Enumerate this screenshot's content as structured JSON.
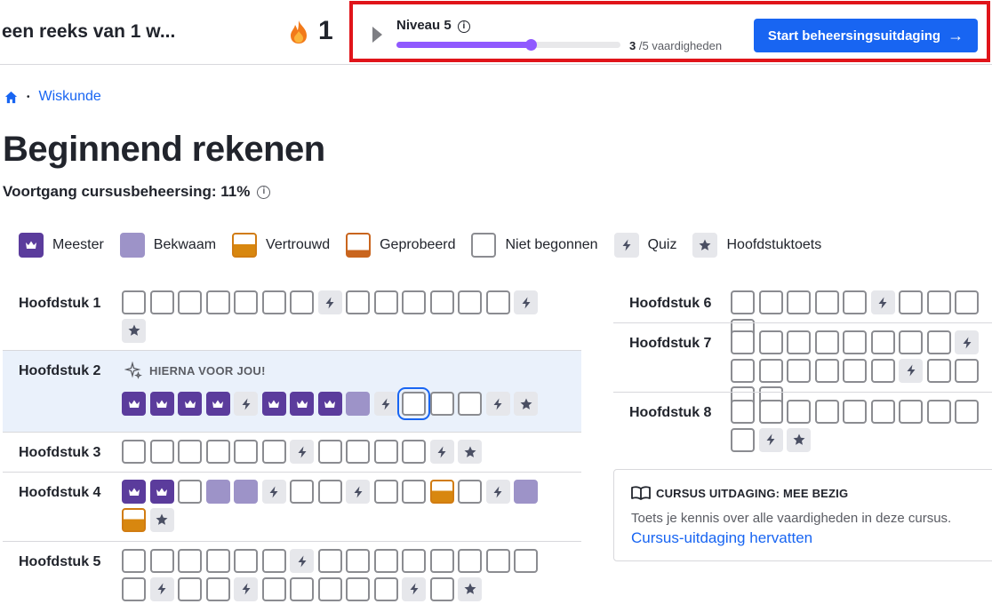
{
  "header": {
    "streak_text": "een reeks van 1 w...",
    "streak_count": "1",
    "flame_icon": "flame-icon",
    "level": {
      "title": "Niveau 5",
      "progress_fraction": 0.6,
      "skills_done": "3",
      "skills_total_text": "/5 vaardigheden",
      "cta_label": "Start beheersingsuitdaging",
      "cta_arrow": "→"
    },
    "colors": {
      "accent": "#1865f2",
      "progress": "#9059ff",
      "highlight_border": "#e0141a"
    }
  },
  "breadcrumb": {
    "home_icon": "home-icon",
    "separator": "•",
    "link": "Wiskunde"
  },
  "page_title": "Beginnend rekenen",
  "mastery": {
    "text": "Voortgang cursusbeheersing: 11%",
    "info_icon": "i"
  },
  "legend": [
    {
      "state": "mastered",
      "label": "Meester"
    },
    {
      "state": "proficient",
      "label": "Bekwaam"
    },
    {
      "state": "familiar",
      "label": "Vertrouwd"
    },
    {
      "state": "attempted",
      "label": "Geprobeerd"
    },
    {
      "state": "empty",
      "label": "Niet begonnen"
    },
    {
      "state": "quiz",
      "label": "Quiz"
    },
    {
      "state": "test",
      "label": "Hoofdstuktoets"
    }
  ],
  "next_up_label": "HIERNA VOOR JOU!",
  "units_left": [
    {
      "label": "Hoofdstuk 1",
      "rows": [
        [
          "empty",
          "empty",
          "empty",
          "empty",
          "empty",
          "empty",
          "empty",
          "quiz",
          "empty",
          "empty",
          "empty",
          "empty",
          "empty",
          "empty",
          "quiz"
        ],
        [
          "test"
        ]
      ]
    },
    {
      "label": "Hoofdstuk 2",
      "next_up": true,
      "rows": [
        [
          "mastered",
          "mastered",
          "mastered",
          "mastered",
          "quiz",
          "mastered",
          "mastered",
          "mastered",
          "proficient",
          "quiz",
          "current",
          "empty",
          "empty",
          "quiz",
          "test"
        ]
      ]
    },
    {
      "label": "Hoofdstuk 3",
      "rows": [
        [
          "empty",
          "empty",
          "empty",
          "empty",
          "empty",
          "empty",
          "quiz",
          "empty",
          "empty",
          "empty",
          "empty",
          "quiz",
          "test"
        ]
      ]
    },
    {
      "label": "Hoofdstuk 4",
      "rows": [
        [
          "mastered",
          "mastered",
          "empty",
          "proficient",
          "proficient",
          "quiz",
          "empty",
          "empty",
          "quiz",
          "empty",
          "empty",
          "familiar",
          "empty",
          "quiz",
          "proficient"
        ],
        [
          "familiar",
          "test"
        ]
      ]
    },
    {
      "label": "Hoofdstuk 5",
      "rows": [
        [
          "empty",
          "empty",
          "empty",
          "empty",
          "empty",
          "empty",
          "quiz",
          "empty",
          "empty",
          "empty",
          "empty",
          "empty",
          "empty",
          "empty",
          "empty"
        ],
        [
          "empty",
          "quiz",
          "empty",
          "empty",
          "quiz",
          "empty",
          "empty",
          "empty",
          "empty",
          "empty",
          "quiz",
          "empty",
          "test"
        ]
      ]
    }
  ],
  "units_right": [
    {
      "label": "Hoofdstuk 6",
      "rows": [
        [
          "empty",
          "empty",
          "empty",
          "empty",
          "empty",
          "quiz",
          "empty",
          "empty",
          "empty",
          "empty"
        ]
      ]
    },
    {
      "label": "Hoofdstuk 7",
      "rows": [
        [
          "empty",
          "empty",
          "empty",
          "empty",
          "empty",
          "empty",
          "empty",
          "empty",
          "quiz",
          "empty"
        ],
        [
          "empty",
          "empty",
          "empty",
          "empty",
          "empty",
          "quiz",
          "empty",
          "empty",
          "empty",
          "empty"
        ]
      ]
    },
    {
      "label": "Hoofdstuk 8",
      "rows": [
        [
          "empty",
          "empty",
          "empty",
          "empty",
          "empty",
          "empty",
          "empty",
          "empty",
          "empty",
          "empty"
        ],
        [
          "quiz",
          "test"
        ]
      ]
    }
  ],
  "challenge": {
    "book_icon": "book-icon",
    "heading": "CURSUS UITDAGING: MEE BEZIG",
    "body": "Toets je kennis over alle vaardigheden in deze cursus.",
    "link": "Cursus-uitdaging hervatten"
  }
}
